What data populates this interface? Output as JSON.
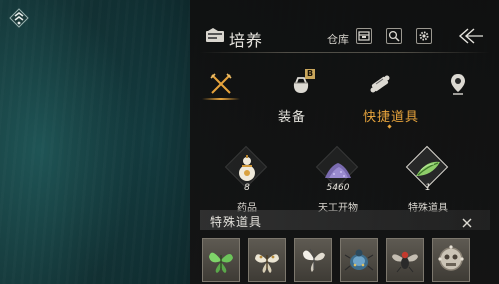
{
  "header": {
    "title": "培养",
    "storage_label": "仓库"
  },
  "category_tabs": [
    {
      "icon": "crossed-swords-icon",
      "active": true
    },
    {
      "icon": "pouch-icon",
      "badge": "B",
      "active": false
    },
    {
      "icon": "scroll-icon",
      "active": false
    },
    {
      "icon": "location-pin-icon",
      "active": false
    }
  ],
  "sub_tabs": {
    "equip": "装备",
    "quick_items": "快捷道具",
    "active": "quick_items"
  },
  "quick_items": [
    {
      "label": "药品",
      "count": "8",
      "icon": "gourd-icon"
    },
    {
      "label": "天工开物",
      "count": "5460",
      "icon": "purple-ore-icon"
    },
    {
      "label": "特殊道具",
      "count": "1",
      "icon": "green-leaf-icon",
      "selected": true
    }
  ],
  "special_panel": {
    "title": "特殊道具",
    "items": [
      {
        "icon": "green-butterfly-icon"
      },
      {
        "icon": "white-moth-icon"
      },
      {
        "icon": "pale-butterfly-icon"
      },
      {
        "icon": "blue-beetle-icon"
      },
      {
        "icon": "red-fly-icon"
      },
      {
        "icon": "skull-ornament-icon"
      }
    ]
  },
  "colors": {
    "accent": "#e6a33c",
    "panel_bg": "#141414",
    "text": "#e4e2dc"
  }
}
